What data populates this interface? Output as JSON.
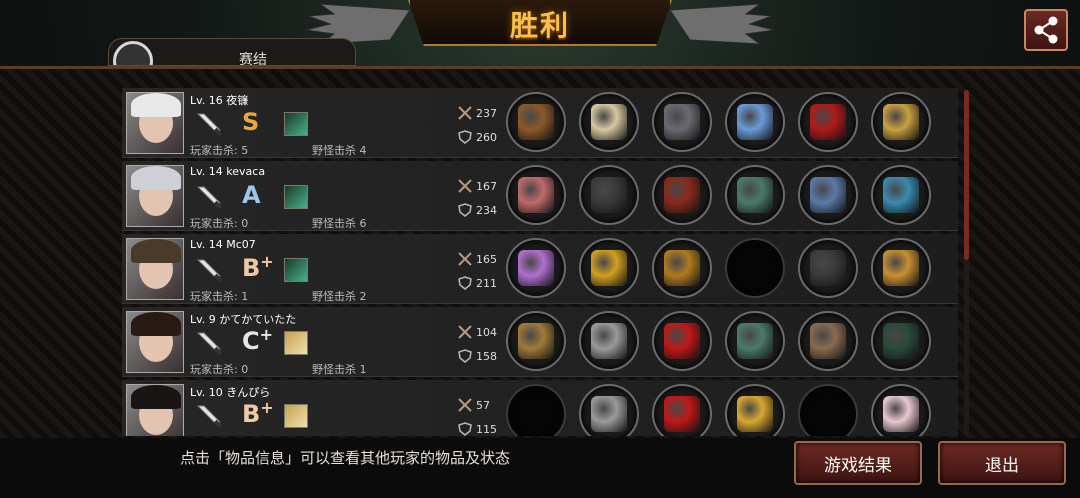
{
  "header": {
    "title": "胜利",
    "partial_tab_text": "赛结",
    "share_icon": "share-icon"
  },
  "colors": {
    "title": "#f7c04a",
    "button_bg": "#6e2a24",
    "grade_s": "#e8a83c",
    "grade_a": "#9cc6ea",
    "grade_b": "#efc9a6",
    "grade_c": "#e6e6e6"
  },
  "players": [
    {
      "level_name": "Lv. 16 夜镰",
      "grade": "S",
      "grade_plus": "",
      "kills": "玩家击杀: 5",
      "monster_kills": "野怪击杀 4",
      "atk": "237",
      "def": "260",
      "weapon_icon": "knife-icon",
      "items": [
        "staff",
        "tiara",
        "armor",
        "bracer",
        "heels",
        "box"
      ]
    },
    {
      "level_name": "Lv. 14 kevaca",
      "grade": "A",
      "grade_plus": "",
      "kills": "玩家击杀: 0",
      "monster_kills": "野怪击杀 6",
      "atk": "167",
      "def": "234",
      "weapon_icon": "knife-icon",
      "items": [
        "blade",
        "helmet",
        "robe",
        "bangle",
        "boots",
        "amulet"
      ]
    },
    {
      "level_name": "Lv. 14 Mc07",
      "grade": "B",
      "grade_plus": "+",
      "kills": "玩家击杀: 1",
      "monster_kills": "野怪击杀 2",
      "atk": "165",
      "def": "211",
      "weapon_icon": "bat-icon",
      "items": [
        "wand",
        "crown",
        "gold-armor",
        "",
        "dark-boots",
        "earrings"
      ]
    },
    {
      "level_name": "Lv. 9  かてかていたた",
      "grade": "C",
      "grade_plus": "+",
      "kills": "玩家击杀: 0",
      "monster_kills": "野怪击杀 1",
      "atk": "104",
      "def": "158",
      "weapon_icon": "bat-icon",
      "items": [
        "whip",
        "ring-band",
        "red-vest",
        "bangle",
        "gauntlet",
        "scope"
      ]
    },
    {
      "level_name": "Lv. 10  きんぴら",
      "grade": "B",
      "grade_plus": "+",
      "kills": "",
      "monster_kills": "",
      "atk": "57",
      "def": "115",
      "weapon_icon": "bat-icon",
      "items": [
        "",
        "ring-band",
        "red-vest",
        "gold-ring",
        "",
        "pearl"
      ]
    }
  ],
  "footer": {
    "hint": "点击「物品信息」可以查看其他玩家的物品及状态",
    "result_button": "游戏结果",
    "exit_button": "退出"
  }
}
